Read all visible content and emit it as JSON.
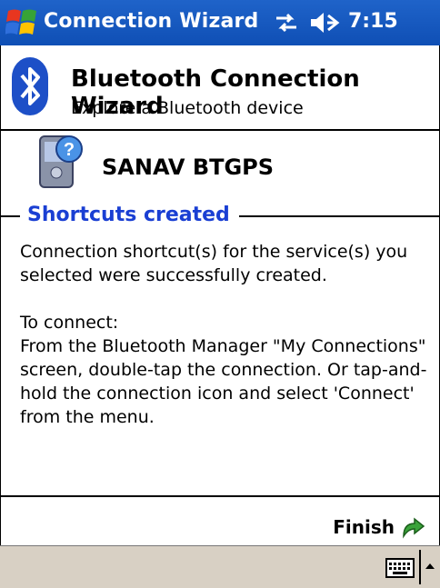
{
  "titlebar": {
    "title": "Connection Wizard",
    "clock": "7:15",
    "icons": [
      "windows-start-icon",
      "connectivity-icon",
      "volume-icon"
    ],
    "bg_color": "#1f63c9"
  },
  "header": {
    "title": "Bluetooth Connection Wizard",
    "subtitle": "Explore a Bluetooth device",
    "icon": "bluetooth-icon"
  },
  "device": {
    "name": "SANAV BTGPS",
    "icon": "pda-device-icon"
  },
  "section": {
    "title": "Shortcuts created",
    "title_color": "#1a3fd3",
    "paragraph1": "Connection shortcut(s)  for the service(s) you selected were successfully created.",
    "paragraph2_lines": [
      "To connect:",
      "From the Bluetooth Manager \"My Connections\" screen, double-tap the connection. Or tap-and-hold the connection icon and select 'Connect' from the menu."
    ]
  },
  "footer": {
    "finish_label": "Finish",
    "finish_icon": "green-arrow-icon"
  },
  "menubar": {
    "icons": [
      "keyboard-icon",
      "up-arrow-icon"
    ],
    "bg_color": "#d8d0c4"
  }
}
